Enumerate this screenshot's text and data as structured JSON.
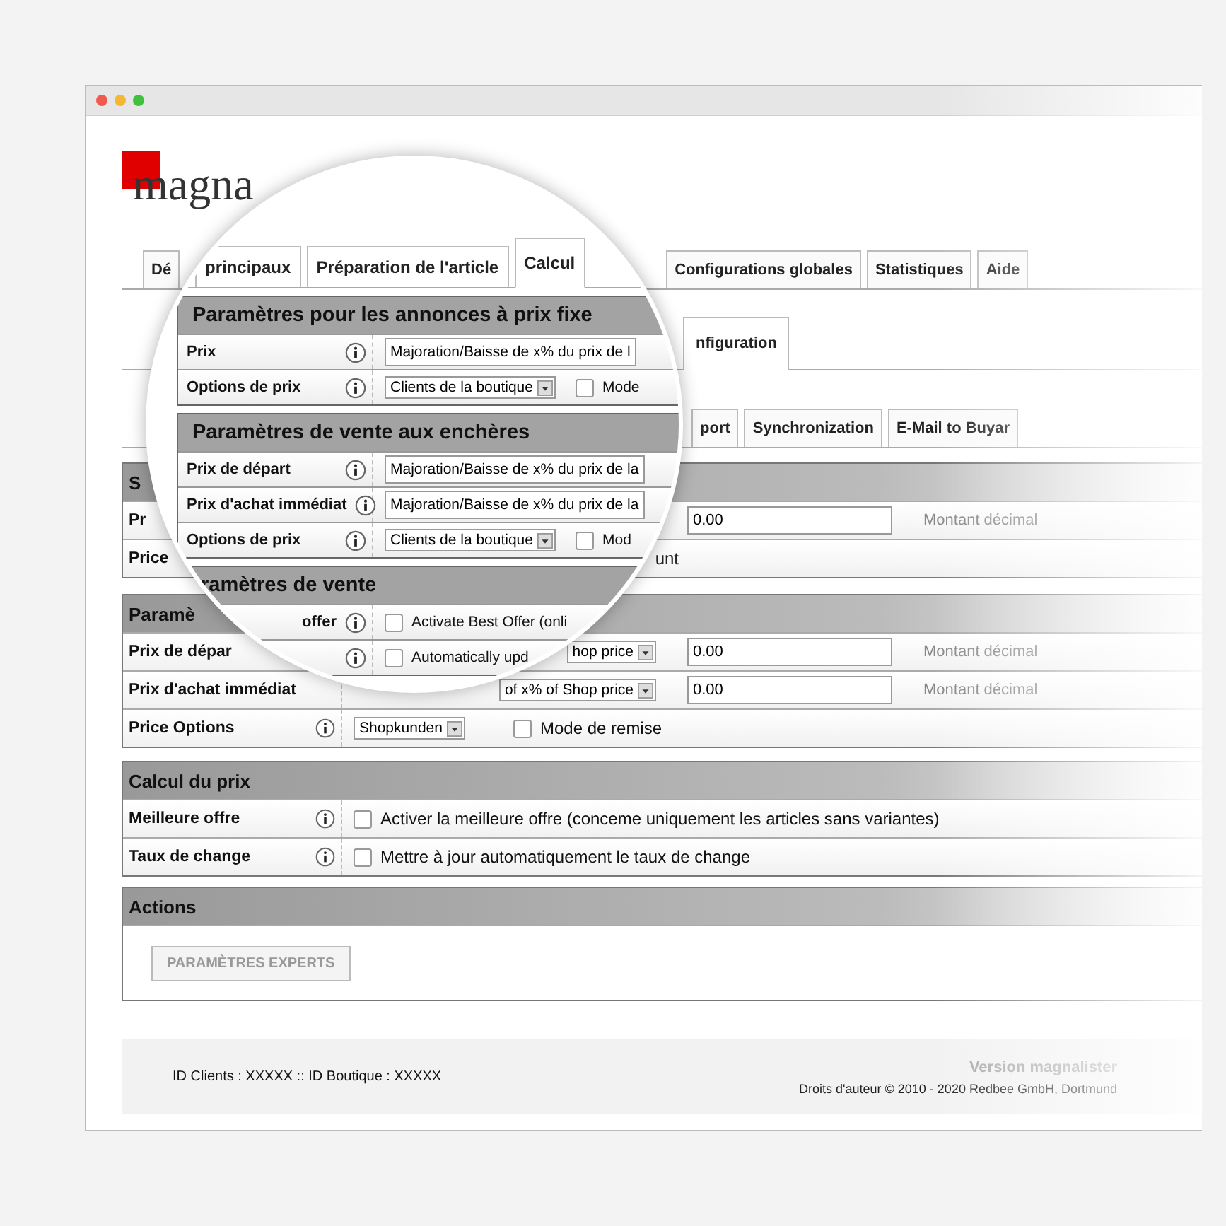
{
  "logo": {
    "text": "magna"
  },
  "tabs_row_1": [
    {
      "label": "Dé",
      "selected": false
    },
    {
      "label": "Configurations globales",
      "selected": false
    },
    {
      "label": "Statistiques",
      "selected": false
    },
    {
      "label": "Aide",
      "selected": false
    }
  ],
  "tabs_row_2": [
    {
      "label": "nfiguration",
      "selected": true
    }
  ],
  "tabs_row_3": [
    {
      "label": "port",
      "selected": false
    },
    {
      "label": "Synchronization",
      "selected": false
    },
    {
      "label": "E-Mail to Buyar",
      "selected": false
    }
  ],
  "sections": [
    {
      "title": "S",
      "rows": [
        {
          "kind": "amount",
          "label": "Pr",
          "value": "0.00",
          "hint": "Montant décimal"
        },
        {
          "kind": "note",
          "label": "Price",
          "note": "unt"
        }
      ]
    },
    {
      "title": "Paramè",
      "rows": [
        {
          "kind": "amount",
          "label": "Prix de dépar",
          "select": "hop price",
          "value": "0.00",
          "hint": "Montant décimal"
        },
        {
          "kind": "amount",
          "label": "Prix d'achat immédiat",
          "select": "of x% of Shop price",
          "value": "0.00",
          "hint": "Montant décimal"
        },
        {
          "kind": "options",
          "label": "Price Options",
          "info": true,
          "select": "Shopkunden",
          "checkbox": {
            "label": "Mode de remise",
            "checked": false
          }
        }
      ]
    },
    {
      "title": "Calcul du prix",
      "rows": [
        {
          "kind": "checkbox",
          "label": "Meilleure offre",
          "info": true,
          "checkbox": {
            "label": "Activer la meilleure offre (conceme uniquement les articles sans variantes)",
            "checked": false
          }
        },
        {
          "kind": "checkbox",
          "label": "Taux de change",
          "info": true,
          "checkbox": {
            "label": "Mettre à jour automatiquement le taux de change",
            "checked": false
          }
        }
      ]
    }
  ],
  "actions": {
    "title": "Actions",
    "button": "PARAMÈTRES EXPERTS"
  },
  "footer": {
    "ids": "ID Clients : XXXXX :: ID Boutique : XXXXX",
    "version": "Version magnalister",
    "copyright": "Droits d'auteur © 2010 - 2020 Redbee GmbH, Dortmund"
  },
  "magnifier": {
    "tabs": [
      {
        "label": "principaux",
        "selected": false
      },
      {
        "label": "Préparation de l'article",
        "selected": false
      },
      {
        "label": "Calcul",
        "selected": true
      }
    ],
    "sections": [
      {
        "title": "Paramètres pour les annonces à prix fixe",
        "rows": [
          {
            "kind": "input",
            "label": "Prix",
            "info": true,
            "value": "Majoration/Baisse de x% du prix de l"
          },
          {
            "kind": "options",
            "label": "Options de prix",
            "info": true,
            "select": "Clients de la boutique",
            "checkbox": {
              "label": "Mode",
              "checked": false
            }
          }
        ]
      },
      {
        "title": "Paramètres de vente aux enchères",
        "rows": [
          {
            "kind": "input",
            "label": "Prix de départ",
            "info": true,
            "value": "Majoration/Baisse de x% du prix de la"
          },
          {
            "kind": "input",
            "label": "Prix d'achat immédiat",
            "info": true,
            "value": "Majoration/Baisse de x% du prix de la"
          },
          {
            "kind": "options",
            "label": "Options de prix",
            "info": true,
            "select": "Clients de la boutique",
            "checkbox": {
              "label": "Mod",
              "checked": false
            }
          }
        ]
      },
      {
        "title": "ramètres de vente",
        "rows": [
          {
            "kind": "checkbox",
            "label": "offer",
            "info": true,
            "checkbox": {
              "label": "Activate Best Offer (onli",
              "checked": false
            }
          },
          {
            "kind": "checkbox",
            "label": "",
            "info": true,
            "checkbox": {
              "label": "Automatically upd",
              "checked": false
            }
          }
        ]
      }
    ]
  }
}
